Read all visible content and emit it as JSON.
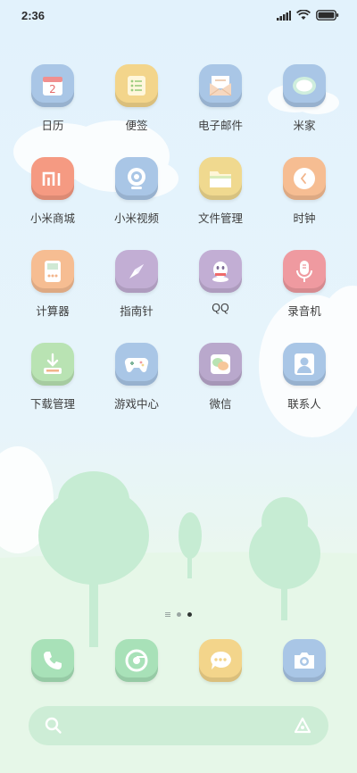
{
  "status_bar": {
    "time": "2:36",
    "icons": [
      "signal-icon",
      "wifi-icon",
      "battery-icon"
    ]
  },
  "apps": [
    {
      "label": "日历",
      "icon": "calendar-icon",
      "color": "#a9c6e6",
      "glyph": "2"
    },
    {
      "label": "便签",
      "icon": "notes-icon",
      "color": "#f3d58b"
    },
    {
      "label": "电子邮件",
      "icon": "email-icon",
      "color": "#a9c6e6"
    },
    {
      "label": "米家",
      "icon": "mijia-icon",
      "color": "#a9c6e6"
    },
    {
      "label": "小米商城",
      "icon": "mi-store-icon",
      "color": "#f59a82",
      "glyph": "mi"
    },
    {
      "label": "小米视频",
      "icon": "video-icon",
      "color": "#a9c6e6"
    },
    {
      "label": "文件管理",
      "icon": "folder-icon",
      "color": "#f0d98f"
    },
    {
      "label": "时钟",
      "icon": "clock-icon",
      "color": "#f6bd92"
    },
    {
      "label": "计算器",
      "icon": "calculator-icon",
      "color": "#f6bd92"
    },
    {
      "label": "指南针",
      "icon": "compass-icon",
      "color": "#c2aed4"
    },
    {
      "label": "QQ",
      "icon": "qq-icon",
      "color": "#c2aed4"
    },
    {
      "label": "录音机",
      "icon": "recorder-icon",
      "color": "#ef9aa0"
    },
    {
      "label": "下载管理",
      "icon": "download-icon",
      "color": "#b9e3b3"
    },
    {
      "label": "游戏中心",
      "icon": "gamepad-icon",
      "color": "#a9c6e6"
    },
    {
      "label": "微信",
      "icon": "wechat-icon",
      "color": "#b9a8cc"
    },
    {
      "label": "联系人",
      "icon": "contacts-icon",
      "color": "#a9c6e6"
    }
  ],
  "dock": [
    {
      "icon": "phone-icon",
      "color": "#a8e1b8"
    },
    {
      "icon": "browser-icon",
      "color": "#a8e1b8"
    },
    {
      "icon": "messages-icon",
      "color": "#f3d58b"
    },
    {
      "icon": "camera-icon",
      "color": "#a9c6e6"
    }
  ],
  "page_indicator": {
    "pages": 3,
    "active": 3
  }
}
